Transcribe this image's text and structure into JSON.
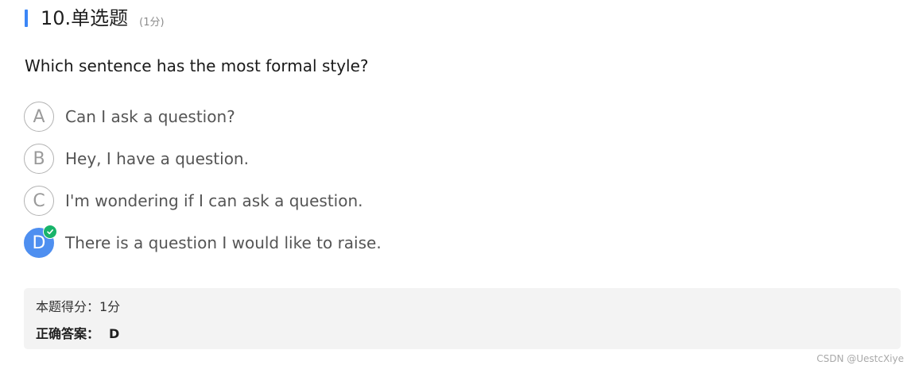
{
  "question": {
    "number_title": "10.单选题",
    "points": "(1分)",
    "stem": "Which sentence has the most formal style?",
    "options": [
      {
        "letter": "A",
        "text": "Can I ask a question?",
        "selected": false
      },
      {
        "letter": "B",
        "text": "Hey, I have a question.",
        "selected": false
      },
      {
        "letter": "C",
        "text": "I'm wondering if I can ask a question.",
        "selected": false
      },
      {
        "letter": "D",
        "text": "There is a question I would like to raise.",
        "selected": true
      }
    ]
  },
  "result": {
    "score_text": "本题得分：1分",
    "answer_label": "正确答案：",
    "answer_value": "D"
  },
  "watermark": "CSDN @UestcXiye",
  "colors": {
    "accent": "#3b86f6",
    "selected_option": "#4e8ff0",
    "correct_badge": "#18b46a"
  },
  "icons": {
    "correct_badge": "check-icon"
  }
}
